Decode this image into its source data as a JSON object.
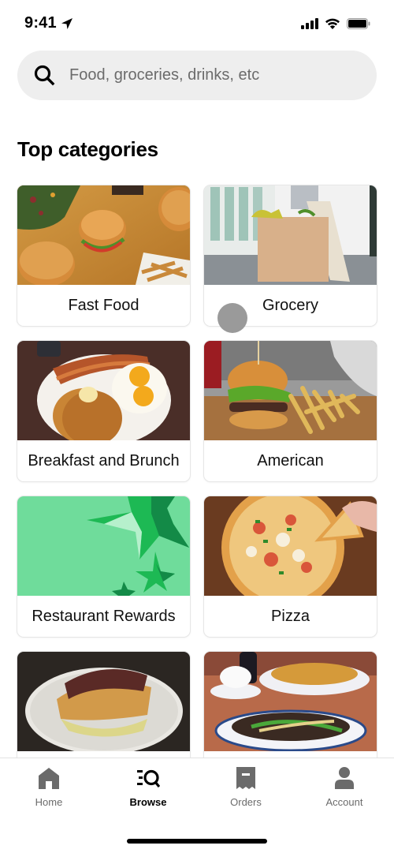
{
  "status_bar": {
    "time": "9:41",
    "icons": [
      "location-arrow-icon",
      "signal-icon",
      "wifi-icon",
      "battery-icon"
    ]
  },
  "search": {
    "placeholder": "Food, groceries, drinks, etc",
    "value": "",
    "icon": "search-icon"
  },
  "section": {
    "title": "Top categories"
  },
  "categories": [
    {
      "label": "Fast Food",
      "image": "burgers-and-fries-photo"
    },
    {
      "label": "Grocery",
      "image": "grocery-bag-photo"
    },
    {
      "label": "Breakfast and Brunch",
      "image": "pancakes-eggs-bacon-photo"
    },
    {
      "label": "American",
      "image": "burger-fries-board-photo"
    },
    {
      "label": "Restaurant Rewards",
      "image": "green-stars-graphic"
    },
    {
      "label": "Pizza",
      "image": "pizza-photo"
    },
    {
      "label": "",
      "image": "sandwich-photo"
    },
    {
      "label": "",
      "image": "chinese-food-photo"
    }
  ],
  "tabbar": {
    "items": [
      {
        "label": "Home",
        "icon": "home-icon",
        "active": false
      },
      {
        "label": "Browse",
        "icon": "browse-icon",
        "active": true
      },
      {
        "label": "Orders",
        "icon": "receipt-icon",
        "active": false
      },
      {
        "label": "Account",
        "icon": "person-icon",
        "active": false
      }
    ]
  },
  "colors": {
    "search_bg": "#eeeeee",
    "rewards_green": "#6fdc9b",
    "star_green": "#1db954",
    "star_dark": "#138a47",
    "tab_inactive": "#6b6b6b",
    "tab_active": "#000000"
  }
}
